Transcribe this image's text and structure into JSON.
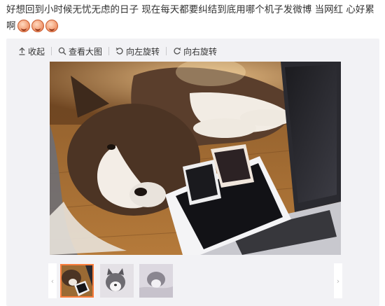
{
  "post": {
    "text": "好想回到小时候无忧无虑的日子 现在每天都要纠结到底用哪个机子发微博 当网红 心好累啊",
    "emoji_icons": [
      "crying-face-icon",
      "crying-face-icon",
      "crying-face-icon"
    ]
  },
  "toolbar": {
    "collapse_label": "收起",
    "view_large_label": "查看大图",
    "rotate_left_label": "向左旋转",
    "rotate_right_label": "向右旋转"
  },
  "gallery": {
    "thumbnail_count": 3,
    "active_index": 0,
    "prev_arrow": "‹",
    "next_arrow": "›",
    "accent_color": "#fa7d3c"
  }
}
